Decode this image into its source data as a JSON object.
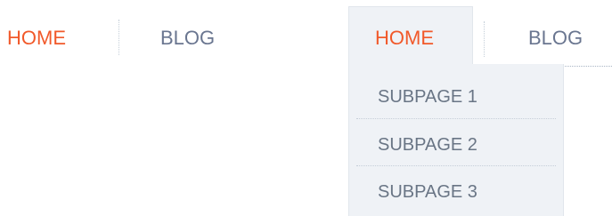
{
  "menu_plain": {
    "home_label": "HOME",
    "blog_label": "BLOG"
  },
  "menu_expanded": {
    "home_label": "HOME",
    "blog_label": "BLOG",
    "subpages": [
      "SUBPAGE 1",
      "SUBPAGE 2",
      "SUBPAGE 3"
    ]
  },
  "colors": {
    "active": "#f1592a",
    "inactive": "#6a7690",
    "dropdown_bg": "#eff2f6"
  }
}
